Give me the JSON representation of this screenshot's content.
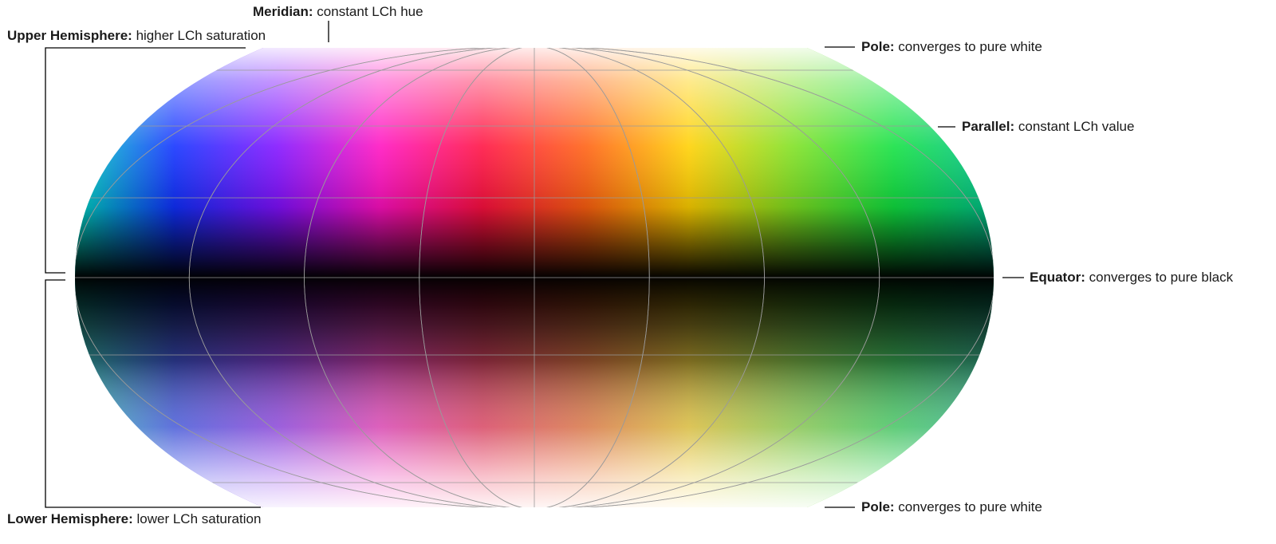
{
  "labels": {
    "meridian": {
      "term": "Meridian:",
      "desc": "constant LCh hue"
    },
    "upper_hemisphere": {
      "term": "Upper Hemisphere:",
      "desc": "higher LCh saturation"
    },
    "lower_hemisphere": {
      "term": "Lower Hemisphere:",
      "desc": "lower LCh saturation"
    },
    "pole_top": {
      "term": "Pole:",
      "desc": "converges to pure white"
    },
    "pole_bottom": {
      "term": "Pole:",
      "desc": "converges to pure white"
    },
    "parallel": {
      "term": "Parallel:",
      "desc": "constant LCh value"
    },
    "equator": {
      "term": "Equator:",
      "desc": "converges to pure black"
    }
  },
  "colors": {
    "hue_stops": [
      "#00e0c0",
      "#1030ff",
      "#8010ff",
      "#ff10c0",
      "#ff1040",
      "#ff6010",
      "#ffd000",
      "#80e020",
      "#10e040",
      "#00c090"
    ],
    "pole": "#ffffff",
    "equator": "#000000",
    "grid": "#9a9a9a",
    "leader": "#000000"
  }
}
